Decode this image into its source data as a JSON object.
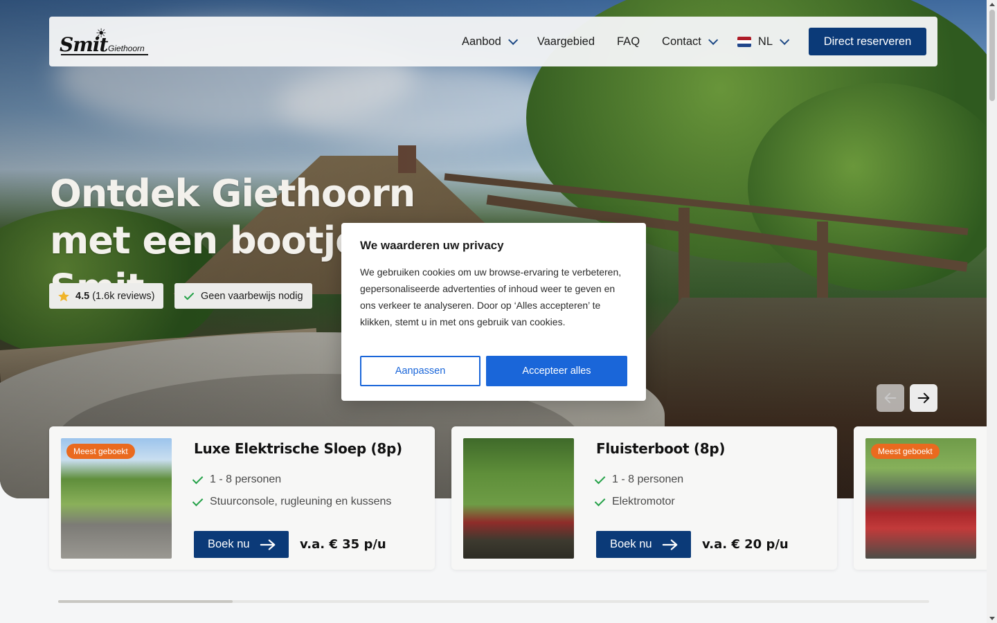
{
  "nav": {
    "logo": {
      "brand": "Smit",
      "sub": "Giethoorn"
    },
    "links": [
      {
        "label": "Aanbod",
        "dropdown": true
      },
      {
        "label": "Vaargebied",
        "dropdown": false
      },
      {
        "label": "FAQ",
        "dropdown": false
      },
      {
        "label": "Contact",
        "dropdown": true
      }
    ],
    "language": {
      "label": "NL",
      "flag_colors": [
        "#ae1c28",
        "#ffffff",
        "#21468b"
      ]
    },
    "cta_label": "Direct reserveren"
  },
  "hero": {
    "title": "Ontdek Giethoorn met een bootje van Smit",
    "rating": {
      "score": "4.5",
      "reviews": "(1.6k reviews)"
    },
    "license_badge": "Geen vaarbewijs nodig"
  },
  "cards": [
    {
      "tag": "Meest geboekt",
      "title": "Luxe Elektrische Sloep (8p)",
      "features": [
        "1 - 8 personen",
        "Stuurconsole, rugleuning en kussens"
      ],
      "book_label": "Boek nu",
      "price": "v.a. € 35 p/u"
    },
    {
      "tag": "",
      "title": "Fluisterboot (8p)",
      "features": [
        "1 - 8 personen",
        "Elektromotor"
      ],
      "book_label": "Boek nu",
      "price": "v.a. € 20 p/u"
    },
    {
      "tag": "Meest geboekt",
      "title": "",
      "features": [],
      "book_label": "",
      "price": ""
    }
  ],
  "carousel": {
    "progress": 0.2
  },
  "cookie_modal": {
    "title": "We waarderen uw privacy",
    "body": "We gebruiken cookies om uw browse-ervaring te verbeteren, gepersonaliseerde advertenties of inhoud weer te geven en ons verkeer te analyseren. Door op ‘Alles accepteren’ te klikken, stemt u in met ons gebruik van cookies.",
    "customize_label": "Aanpassen",
    "accept_label": "Accepteer alles"
  },
  "colors": {
    "brand_blue": "#0b3a78",
    "cookie_blue": "#1a66d9",
    "tag_orange": "#ea6a1f",
    "check_green": "#24a148",
    "star_gold": "#f0b429"
  }
}
